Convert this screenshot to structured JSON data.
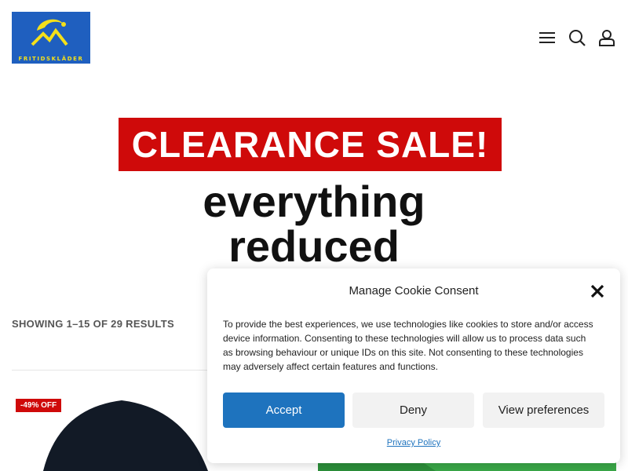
{
  "site": {
    "logo_text": "FRITIDSKLÄDER",
    "colors": {
      "logo_bg": "#1f5fbf",
      "logo_yellow": "#f4e01a",
      "sale_red": "#cf0a0a",
      "accent_blue": "#1e73be"
    }
  },
  "header": {
    "icons": [
      "menu-icon",
      "search-icon",
      "user-icon"
    ]
  },
  "hero": {
    "banner": "CLEARANCE SALE!",
    "line1": "everything",
    "line2": "reduced"
  },
  "shop": {
    "results_count": "SHOWING 1–15 OF 29 RESULTS",
    "products": [
      {
        "badge": "-49% OFF"
      }
    ]
  },
  "cookie_dialog": {
    "title": "Manage Cookie Consent",
    "body": "To provide the best experiences, we use technologies like cookies to store and/or access device information. Consenting to these technologies will allow us to process data such as browsing behaviour or unique IDs on this site. Not consenting to these technologies may adversely affect certain features and functions.",
    "accept": "Accept",
    "deny": "Deny",
    "preferences": "View preferences",
    "privacy": "Privacy Policy"
  }
}
